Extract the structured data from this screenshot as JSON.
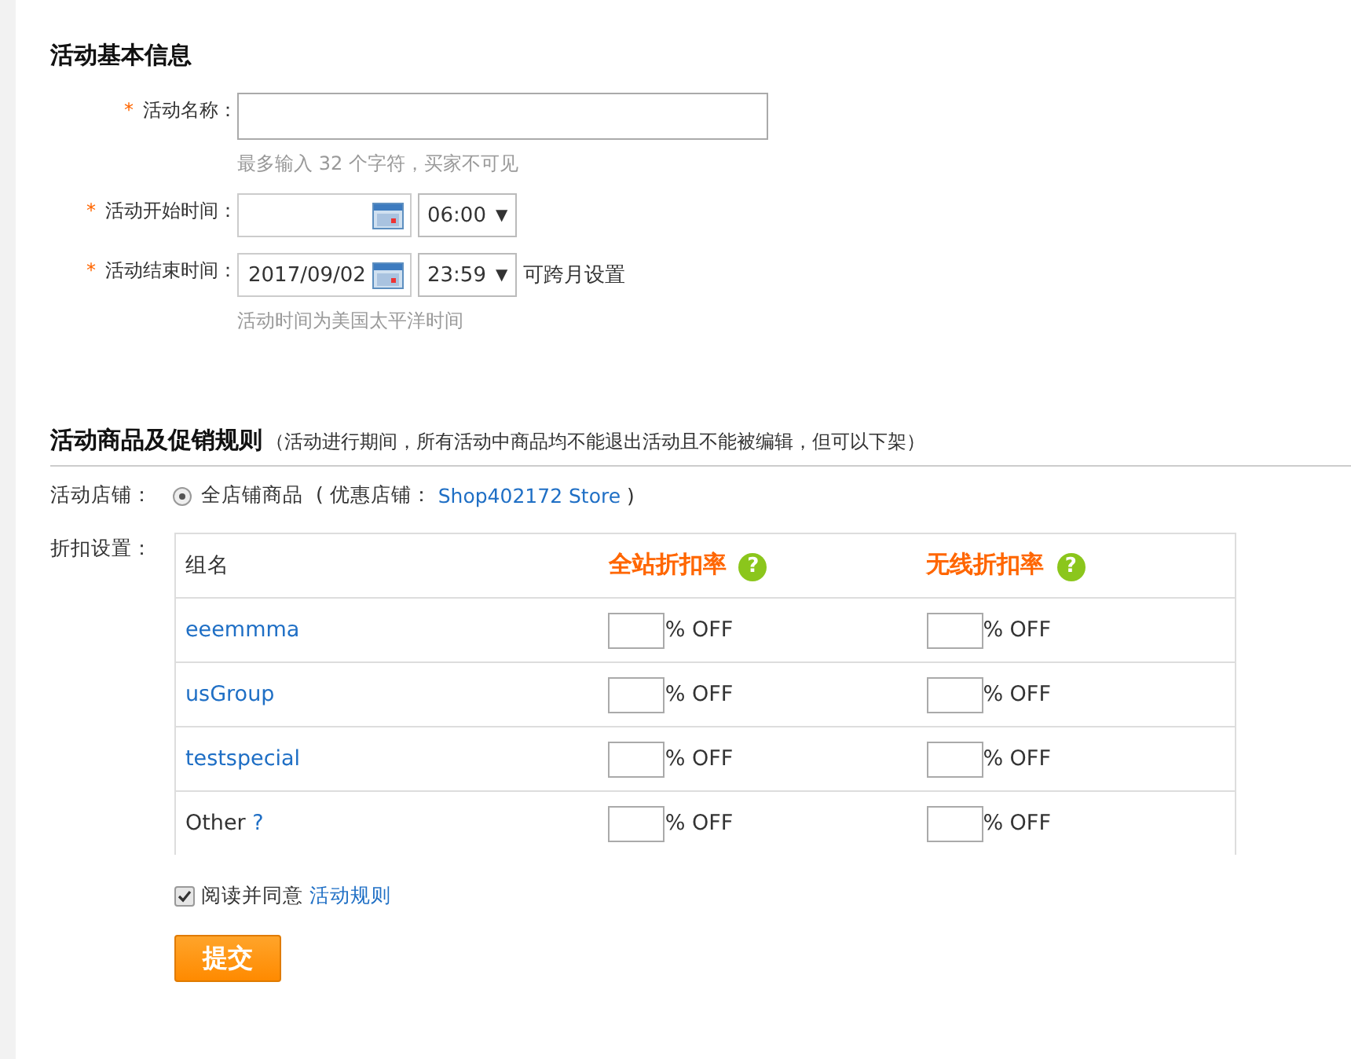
{
  "basic_info": {
    "title": "活动基本信息",
    "fields": [
      {
        "kind": "text",
        "required_mark": "*",
        "label": "活动名称：",
        "hint": "最多输入 32 个字符，买家不可见"
      },
      {
        "kind": "datetime",
        "required_mark": "*",
        "label": "活动开始时间：",
        "time": "06:00",
        "caret": "▼"
      },
      {
        "kind": "datetime",
        "required_mark": "*",
        "label": "活动结束时间：",
        "date": "2017/09/02",
        "time": "23:59",
        "caret": "▼",
        "note": "可跨月设置",
        "hint": "活动时间为美国太平洋时间"
      }
    ]
  },
  "promo": {
    "title": "活动商品及促销规则",
    "subtitle": "（活动进行期间，所有活动中商品均不能退出活动且不能被编辑，但可以下架）",
    "store_label": "活动店铺：",
    "store_option": {
      "label": "全店铺商品",
      "selected": true,
      "prefix": "( 优惠店铺：",
      "store": "Shop402172 Store",
      "suffix": ")"
    },
    "discount_label": "折扣设置：",
    "table": {
      "columns": [
        {
          "kind": "plain",
          "label": "组名"
        },
        {
          "kind": "rate",
          "label": "全站折扣率",
          "help": "?"
        },
        {
          "kind": "rate",
          "label": "无线折扣率",
          "help": "?"
        }
      ],
      "rows": [
        {
          "cells": [
            {
              "kind": "link",
              "text": "eeemmma"
            },
            {
              "kind": "rate",
              "text": "% OFF"
            },
            {
              "kind": "rate",
              "text": "% OFF"
            }
          ]
        },
        {
          "cells": [
            {
              "kind": "link",
              "text": "usGroup"
            },
            {
              "kind": "rate",
              "text": "% OFF"
            },
            {
              "kind": "rate",
              "text": "% OFF"
            }
          ]
        },
        {
          "cells": [
            {
              "kind": "link",
              "text": "testspecial"
            },
            {
              "kind": "rate",
              "text": "% OFF"
            },
            {
              "kind": "rate",
              "text": "% OFF"
            }
          ]
        },
        {
          "cells": [
            {
              "kind": "plain",
              "text": "Other",
              "help": "?"
            },
            {
              "kind": "rate",
              "text": "% OFF"
            },
            {
              "kind": "rate",
              "text": "% OFF"
            }
          ]
        }
      ]
    },
    "agree": {
      "checked": true,
      "label": "阅读并同意",
      "link": "活动规则"
    },
    "submit": "提交"
  }
}
